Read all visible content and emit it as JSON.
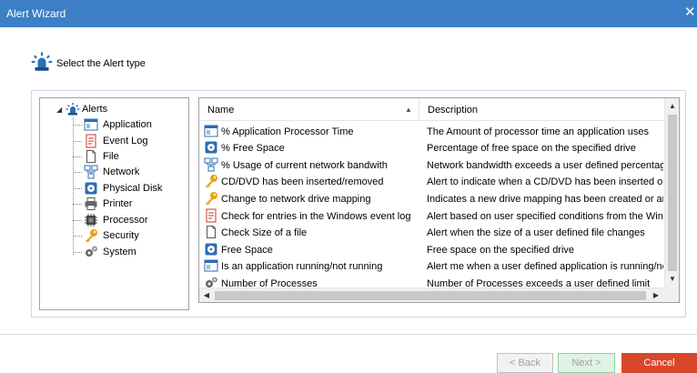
{
  "window": {
    "title": "Alert Wizard",
    "close_glyph": "✕"
  },
  "header": {
    "text": "Select the Alert type",
    "icon": "siren-icon"
  },
  "tree": {
    "root": {
      "label": "Alerts",
      "icon": "siren-icon",
      "expanded": true
    },
    "items": [
      {
        "label": "Application",
        "icon": "application-window-icon"
      },
      {
        "label": "Event Log",
        "icon": "event-log-icon"
      },
      {
        "label": "File",
        "icon": "file-icon"
      },
      {
        "label": "Network",
        "icon": "network-icon"
      },
      {
        "label": "Physical Disk",
        "icon": "disk-icon"
      },
      {
        "label": "Printer",
        "icon": "printer-icon"
      },
      {
        "label": "Processor",
        "icon": "processor-icon"
      },
      {
        "label": "Security",
        "icon": "key-icon"
      },
      {
        "label": "System",
        "icon": "gears-icon"
      }
    ]
  },
  "list": {
    "columns": {
      "name": "Name",
      "description": "Description"
    },
    "rows": [
      {
        "name": "% Application Processor Time",
        "description": "The Amount of processor time an application uses",
        "icon": "application-window-icon"
      },
      {
        "name": "% Free Space",
        "description": "Percentage of free space on the specified drive",
        "icon": "disk-icon"
      },
      {
        "name": "% Usage of current network bandwith",
        "description": "Network bandwidth exceeds a user defined percentage",
        "icon": "network-icon"
      },
      {
        "name": "CD/DVD has been inserted/removed",
        "description": "Alert to indicate when a CD/DVD has been inserted or re",
        "icon": "key-icon"
      },
      {
        "name": "Change to network drive mapping",
        "description": "Indicates a new drive mapping has been created or an e",
        "icon": "key-icon"
      },
      {
        "name": "Check for entries in the Windows event log",
        "description": "Alert based on user specified conditions from the Windov",
        "icon": "event-log-icon"
      },
      {
        "name": "Check Size of a file",
        "description": "Alert when the size of a user defined file changes",
        "icon": "file-icon"
      },
      {
        "name": "Free Space",
        "description": "Free space on the specified drive",
        "icon": "disk-icon"
      },
      {
        "name": "Is an application running/not running",
        "description": "Alert me when a user defined application is running/not r",
        "icon": "application-window-icon"
      },
      {
        "name": "Number of Processes",
        "description": "Number of Processes exceeds a user defined limit",
        "icon": "gears-icon"
      }
    ]
  },
  "buttons": {
    "back": "< Back",
    "next": "Next >",
    "cancel": "Cancel"
  },
  "colors": {
    "titlebar": "#3c7fc6",
    "cancel": "#d9472b",
    "next_border": "#8fd0a0"
  }
}
